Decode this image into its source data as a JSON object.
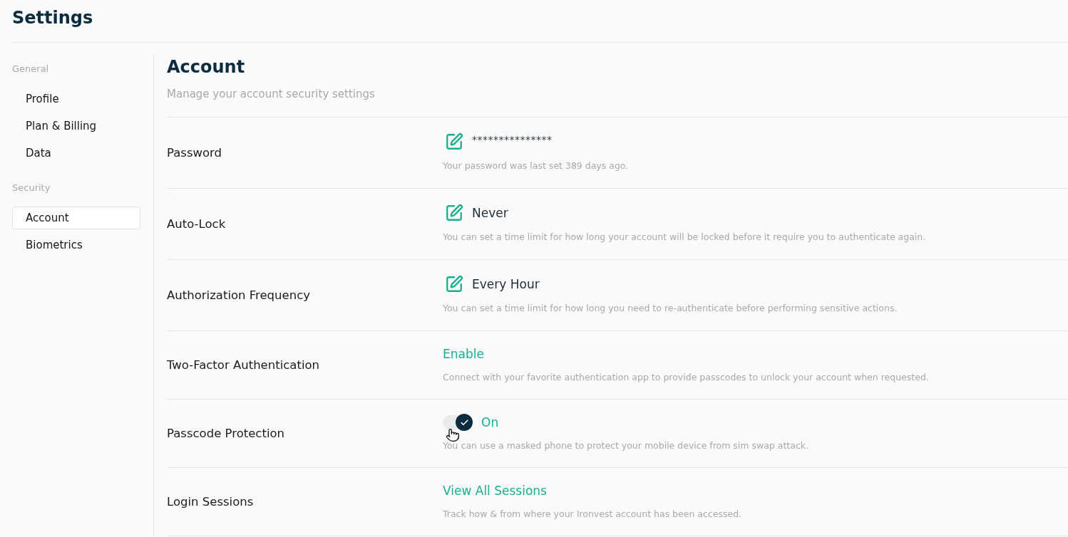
{
  "header": {
    "title": "Settings"
  },
  "sidebar": {
    "sections": [
      {
        "heading": "General",
        "items": [
          {
            "label": "Profile",
            "selected": false
          },
          {
            "label": "Plan & Billing",
            "selected": false
          },
          {
            "label": "Data",
            "selected": false
          }
        ]
      },
      {
        "heading": "Security",
        "items": [
          {
            "label": "Account",
            "selected": true
          },
          {
            "label": "Biometrics",
            "selected": false
          }
        ]
      }
    ]
  },
  "content": {
    "title": "Account",
    "subtitle": "Manage your account security settings",
    "rows": [
      {
        "label": "Password",
        "kind": "secret",
        "value": "***************",
        "description": "Your password was last set 389 days ago."
      },
      {
        "label": "Auto-Lock",
        "kind": "edit",
        "value": "Never",
        "description": "You can set a time limit for how long your account will be locked before it require you to authenticate again."
      },
      {
        "label": "Authorization Frequency",
        "kind": "edit",
        "value": "Every Hour",
        "description": "You can set a time limit for how long you need to re-authenticate before performing sensitive actions."
      },
      {
        "label": "Two-Factor Authentication",
        "kind": "link",
        "value": "Enable",
        "description": "Connect with your favorite authentication app to provide passcodes to unlock your account when requested."
      },
      {
        "label": "Passcode Protection",
        "kind": "toggle",
        "on": true,
        "value": "On",
        "description": "You can use a masked phone to protect your mobile device from sim swap attack."
      },
      {
        "label": "Login Sessions",
        "kind": "link",
        "value": "View All Sessions",
        "description": "Track how & from where your Ironvest account has been accessed."
      }
    ]
  }
}
